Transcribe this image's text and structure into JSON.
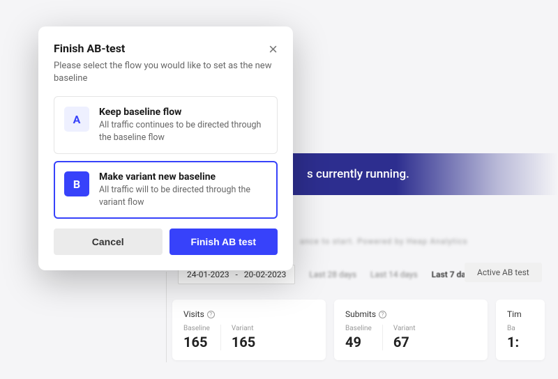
{
  "banner": {
    "text": "s currently running."
  },
  "blurText": "ance to start. Powered by Heap Analytics",
  "dateRange": {
    "start": "24-01-2023",
    "sep": "-",
    "end": "20-02-2023"
  },
  "datePresets": {
    "option1": "Last 28 days",
    "option2": "Last 14 days",
    "option3": "Last 7 days",
    "activeTest": "Active AB test"
  },
  "stats": {
    "visits": {
      "title": "Visits",
      "baselineLabel": "Baseline",
      "baselineValue": "165",
      "variantLabel": "Variant",
      "variantValue": "165"
    },
    "submits": {
      "title": "Submits",
      "baselineLabel": "Baseline",
      "baselineValue": "49",
      "variantLabel": "Variant",
      "variantValue": "67"
    },
    "time": {
      "title": "Tim",
      "baselineLabel": "Ba",
      "baselineValue": "1:"
    }
  },
  "modal": {
    "title": "Finish AB-test",
    "subtitle": "Please select the flow you would like to set as the new baseline",
    "optionA": {
      "badge": "A",
      "title": "Keep baseline flow",
      "desc": "All traffic continues to be directed through the baseline flow"
    },
    "optionB": {
      "badge": "B",
      "title": "Make variant new baseline",
      "desc": "All traffic will to be directed through the variant flow"
    },
    "cancelLabel": "Cancel",
    "finishLabel": "Finish AB test"
  }
}
